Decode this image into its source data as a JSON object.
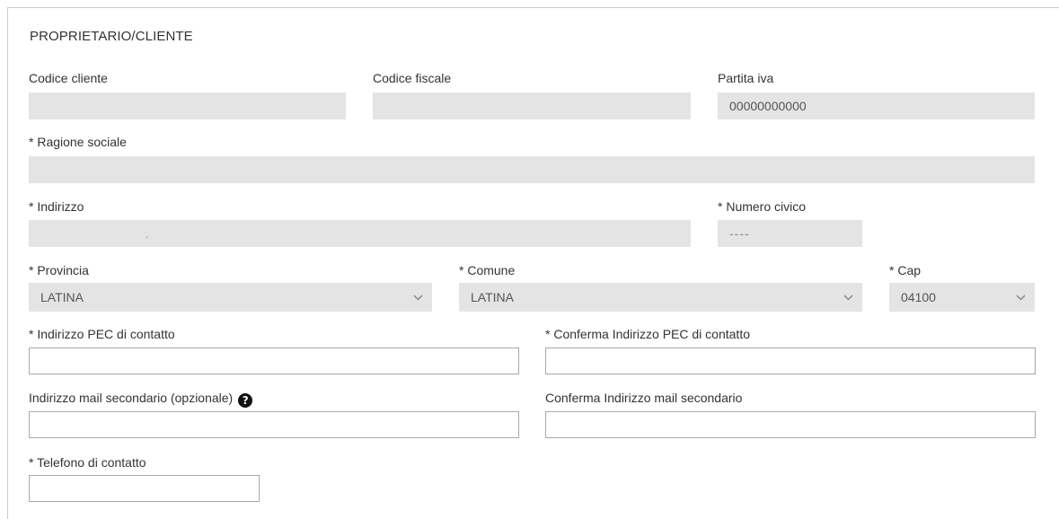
{
  "section": {
    "title": "PROPRIETARIO/CLIENTE"
  },
  "fields": {
    "codice_cliente": {
      "label": "Codice cliente",
      "value": ""
    },
    "codice_fiscale": {
      "label": "Codice fiscale",
      "value": ""
    },
    "partita_iva": {
      "label": "Partita iva",
      "value": "00000000000"
    },
    "ragione_sociale": {
      "label": "* Ragione sociale",
      "value": ""
    },
    "indirizzo": {
      "label": "* Indirizzo",
      "value": "."
    },
    "numero_civico": {
      "label": "* Numero civico",
      "value": "----"
    },
    "provincia": {
      "label": "* Provincia",
      "value": "LATINA"
    },
    "comune": {
      "label": "* Comune",
      "value": "LATINA"
    },
    "cap": {
      "label": "* Cap",
      "value": "04100"
    },
    "pec": {
      "label": "* Indirizzo PEC di contatto",
      "value": ""
    },
    "pec_conferma": {
      "label": "* Conferma Indirizzo PEC di contatto",
      "value": ""
    },
    "mail_secondaria": {
      "label": "Indirizzo mail secondario (opzionale)",
      "value": ""
    },
    "mail_secondaria_conferma": {
      "label": "Conferma Indirizzo mail secondario",
      "value": ""
    },
    "telefono": {
      "label": "* Telefono di contatto",
      "value": ""
    }
  },
  "icons": {
    "help": "question-circle-icon",
    "chevron": "chevron-down-icon"
  }
}
